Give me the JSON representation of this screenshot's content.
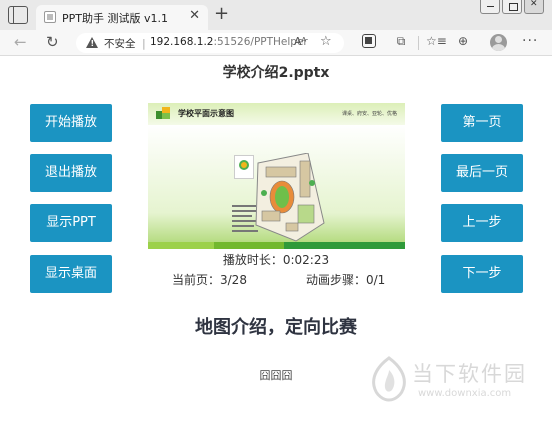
{
  "browser": {
    "tab_title": "PPT助手 测试版 v1.1",
    "tab_close": "✕",
    "new_tab": "+",
    "security_label": "不安全",
    "url_host": "192.168.1.2",
    "url_rest": ":51526/PPTHelper",
    "read_aloud": "Aᴬ",
    "icons": {
      "back": "←",
      "reload": "↻",
      "favorite": "☆",
      "extensions": "⧉",
      "favorites_bar": "☆≡",
      "collections": "⊕",
      "more": "···"
    }
  },
  "app": {
    "file_name": "学校介绍2.pptx",
    "left_buttons": [
      "开始播放",
      "退出播放",
      "显示PPT",
      "显示桌面"
    ],
    "right_buttons": [
      "第一页",
      "最后一页",
      "上一步",
      "下一步"
    ],
    "play_time": "播放时长：0:02:23",
    "current_page": "当前页：3/28",
    "anim_steps": "动画步骤：0/1",
    "slide_heading": "地图介绍，定向比赛",
    "slide_note": "囧囧囧",
    "accent_color": "#1b94c2"
  },
  "slide_preview": {
    "title": "学校平面示意图",
    "subtitle": "课桌、府安、亚轮、优格"
  },
  "watermark": {
    "text": "当下软件园",
    "url": "www.downxia.com"
  }
}
